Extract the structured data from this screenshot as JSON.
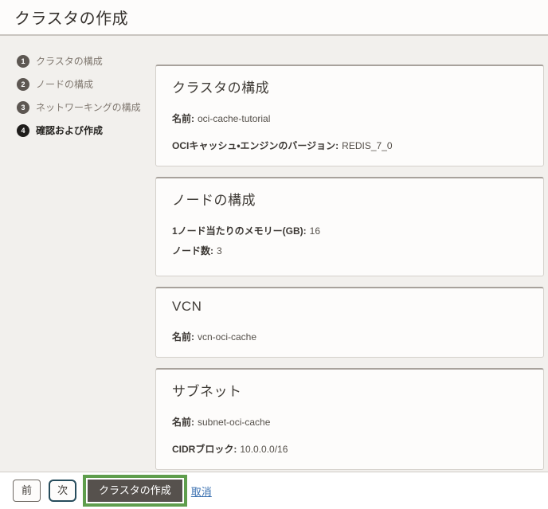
{
  "header": {
    "title": "クラスタの作成"
  },
  "steps": [
    {
      "number": "1",
      "label": "クラスタの構成",
      "active": false
    },
    {
      "number": "2",
      "label": "ノードの構成",
      "active": false
    },
    {
      "number": "3",
      "label": "ネットワーキングの構成",
      "active": false
    },
    {
      "number": "4",
      "label": "確認および作成",
      "active": true
    }
  ],
  "panels": [
    {
      "title": "クラスタの構成",
      "fields": [
        {
          "label": "名前:",
          "value": "oci-cache-tutorial"
        },
        {
          "label": "OCIキャッシュ・エンジンのバージョン:",
          "value": "REDIS_7_0"
        }
      ]
    },
    {
      "title": "ノードの構成",
      "fields": [
        {
          "label": "1ノード当たりのメモリー(GB):",
          "value": "16"
        },
        {
          "label": "ノード数:",
          "value": "3"
        }
      ]
    },
    {
      "title": "VCN",
      "fields": [
        {
          "label": "名前:",
          "value": "vcn-oci-cache"
        }
      ]
    },
    {
      "title": "サブネット",
      "fields": [
        {
          "label": "名前:",
          "value": "subnet-oci-cache"
        },
        {
          "label": "CIDRブロック:",
          "value": "10.0.0.0/16"
        }
      ]
    }
  ],
  "footer": {
    "previous_label": "前",
    "next_label": "次",
    "create_label": "クラスタの作成",
    "cancel_label": "取消"
  },
  "colors": {
    "highlight_green": "#5f9e4d",
    "primary_button_bg": "#56514d",
    "link_blue": "#3a70b0",
    "step_circle": "#5d5752",
    "step_circle_active": "#1f1d1b",
    "content_background": "#f2f0ed"
  }
}
